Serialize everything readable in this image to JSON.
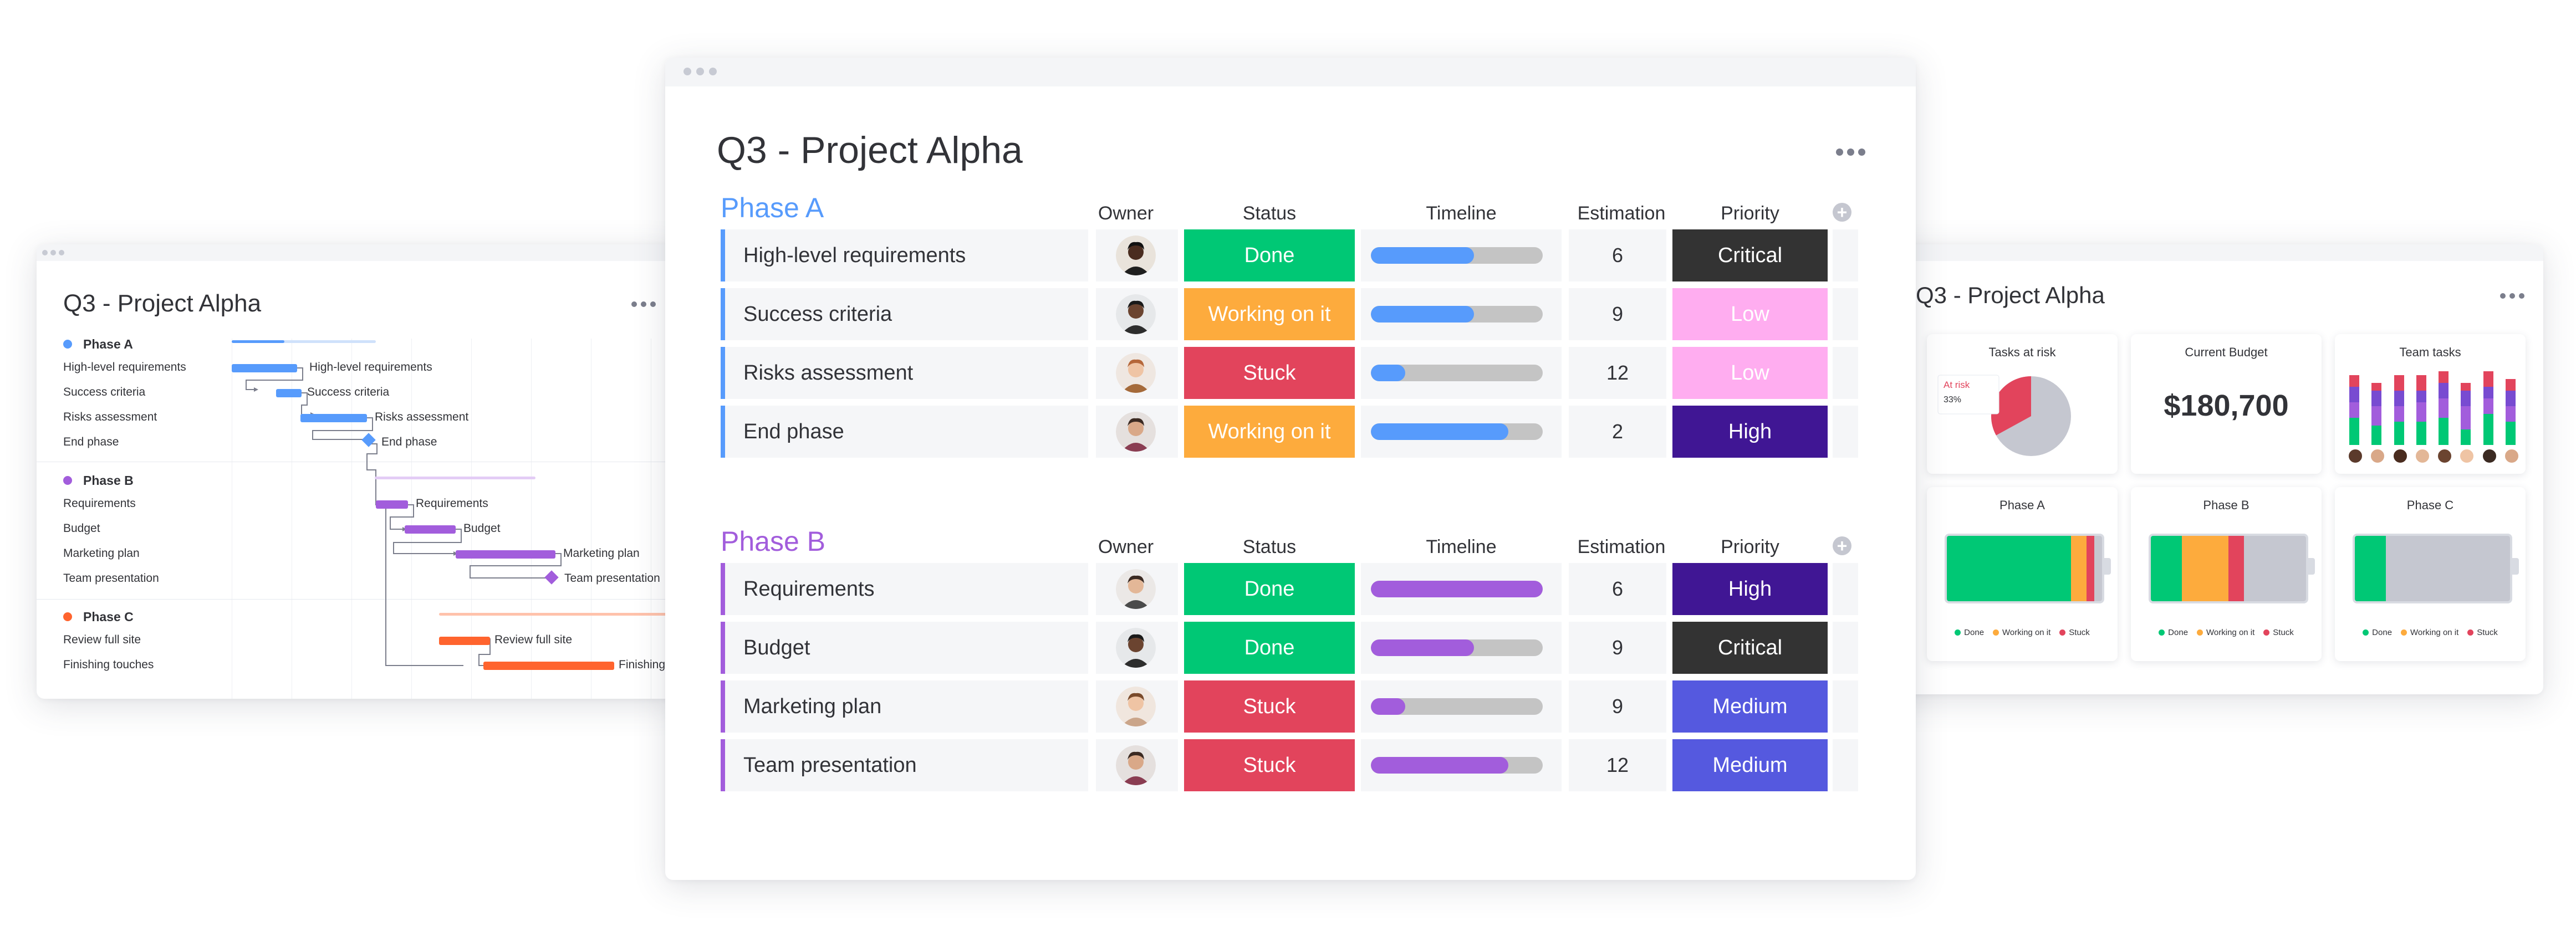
{
  "colors": {
    "done": "#00c875",
    "working": "#fdab3d",
    "stuck": "#e2445c",
    "critical": "#333333",
    "low": "#ffadf0",
    "high": "#401694",
    "medium": "#5559df",
    "phase_a": "#579bfc",
    "phase_b": "#a25ddc",
    "phase_c": "#ff642e",
    "progress_bg": "#c4c4c4"
  },
  "main": {
    "title": "Q3 - Project Alpha",
    "more_icon": "more-horizontal-icon",
    "columns": [
      "Owner",
      "Status",
      "Timeline",
      "Estimation",
      "Priority"
    ],
    "add_column_icon": "plus-circle-icon",
    "groups": [
      {
        "name": "Phase A",
        "color": "#579bfc",
        "items": [
          {
            "name": "High-level requirements",
            "status": "Done",
            "status_color": "#00c875",
            "timeline_progress": 0.6,
            "estimation": "6",
            "priority": "Critical",
            "priority_color": "#333333"
          },
          {
            "name": "Success criteria",
            "status": "Working on it",
            "status_color": "#fdab3d",
            "timeline_progress": 0.6,
            "estimation": "9",
            "priority": "Low",
            "priority_color": "#ffadf0"
          },
          {
            "name": "Risks assessment",
            "status": "Stuck",
            "status_color": "#e2445c",
            "timeline_progress": 0.2,
            "estimation": "12",
            "priority": "Low",
            "priority_color": "#ffadf0"
          },
          {
            "name": "End phase",
            "status": "Working on it",
            "status_color": "#fdab3d",
            "timeline_progress": 0.8,
            "estimation": "2",
            "priority": "High",
            "priority_color": "#401694"
          }
        ]
      },
      {
        "name": "Phase B",
        "color": "#a25ddc",
        "items": [
          {
            "name": "Requirements",
            "status": "Done",
            "status_color": "#00c875",
            "timeline_progress": 1.0,
            "estimation": "6",
            "priority": "High",
            "priority_color": "#401694"
          },
          {
            "name": "Budget",
            "status": "Done",
            "status_color": "#00c875",
            "timeline_progress": 0.6,
            "estimation": "9",
            "priority": "Critical",
            "priority_color": "#333333"
          },
          {
            "name": "Marketing plan",
            "status": "Stuck",
            "status_color": "#e2445c",
            "timeline_progress": 0.2,
            "estimation": "9",
            "priority": "Medium",
            "priority_color": "#5559df"
          },
          {
            "name": "Team presentation",
            "status": "Stuck",
            "status_color": "#e2445c",
            "timeline_progress": 0.8,
            "estimation": "12",
            "priority": "Medium",
            "priority_color": "#5559df"
          }
        ]
      }
    ]
  },
  "gantt": {
    "title": "Q3 - Project Alpha",
    "phase_a": {
      "name": "Phase A",
      "items": [
        "High-level requirements",
        "Success criteria",
        "Risks assessment",
        "End phase"
      ]
    },
    "phase_b": {
      "name": "Phase B",
      "items": [
        "Requirements",
        "Budget",
        "Marketing plan",
        "Team presentation"
      ]
    },
    "phase_c": {
      "name": "Phase C",
      "items": [
        "Review full site",
        "Finishing touches"
      ]
    },
    "bar_labels": [
      "High-level requirements",
      "Success criteria",
      "Risks assessment",
      "End phase",
      "Requirements",
      "Budget",
      "Marketing plan",
      "Team presentation",
      "Review full site",
      "Finishing"
    ]
  },
  "dashboard": {
    "title": "Q3 - Project Alpha",
    "tasks_at_risk": {
      "title": "Tasks at risk",
      "tooltip_label": "At risk",
      "tooltip_value": "33%",
      "value": 0.33
    },
    "current_budget": {
      "title": "Current Budget",
      "value": "$180,700"
    },
    "team_tasks": {
      "title": "Team tasks"
    },
    "phase_cards": [
      {
        "title": "Phase A",
        "done": 0.8,
        "working": 0.1,
        "stuck": 0.05
      },
      {
        "title": "Phase B",
        "done": 0.2,
        "working": 0.3,
        "stuck": 0.1
      },
      {
        "title": "Phase C",
        "done": 0.2,
        "working": 0.0,
        "stuck": 0.0
      }
    ],
    "legend": [
      "Done",
      "Working on it",
      "Stuck"
    ]
  }
}
